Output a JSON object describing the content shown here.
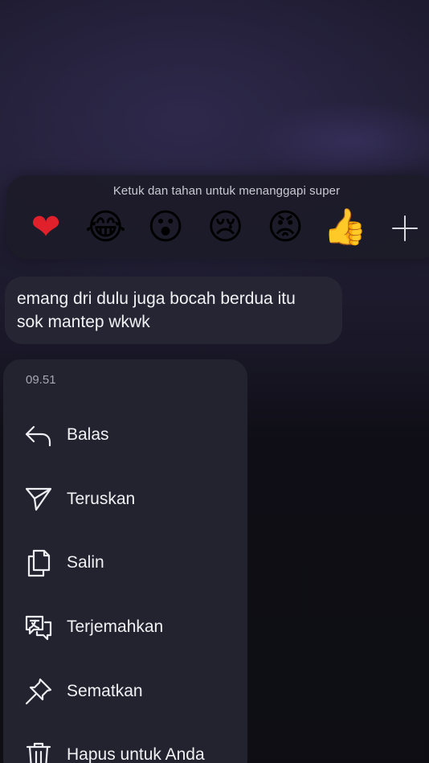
{
  "reactions": {
    "hint": "Ketuk dan tahan untuk menanggapi super",
    "emojis": [
      {
        "name": "heart",
        "glyph": "❤"
      },
      {
        "name": "tears-of-joy",
        "glyph": "😂"
      },
      {
        "name": "surprised",
        "glyph": "😮"
      },
      {
        "name": "crying",
        "glyph": "😢"
      },
      {
        "name": "angry",
        "glyph": "😡"
      },
      {
        "name": "thumbs-up",
        "glyph": "👍"
      }
    ],
    "more_icon": "plus-icon"
  },
  "message": {
    "text": "emang dri dulu juga bocah berdua itu\nsok mantep wkwk"
  },
  "menu": {
    "time": "09.51",
    "items": [
      {
        "label": "Balas",
        "icon": "reply-icon"
      },
      {
        "label": "Teruskan",
        "icon": "forward-icon"
      },
      {
        "label": "Salin",
        "icon": "copy-icon"
      },
      {
        "label": "Terjemahkan",
        "icon": "translate-icon"
      },
      {
        "label": "Sematkan",
        "icon": "pin-icon"
      },
      {
        "label": "Hapus untuk Anda",
        "icon": "trash-icon"
      }
    ]
  },
  "colors": {
    "background": "#141320",
    "panel": "#23222f",
    "bubble": "#262533",
    "text": "#f1f1f4",
    "muted_text": "#a7a7b2"
  }
}
